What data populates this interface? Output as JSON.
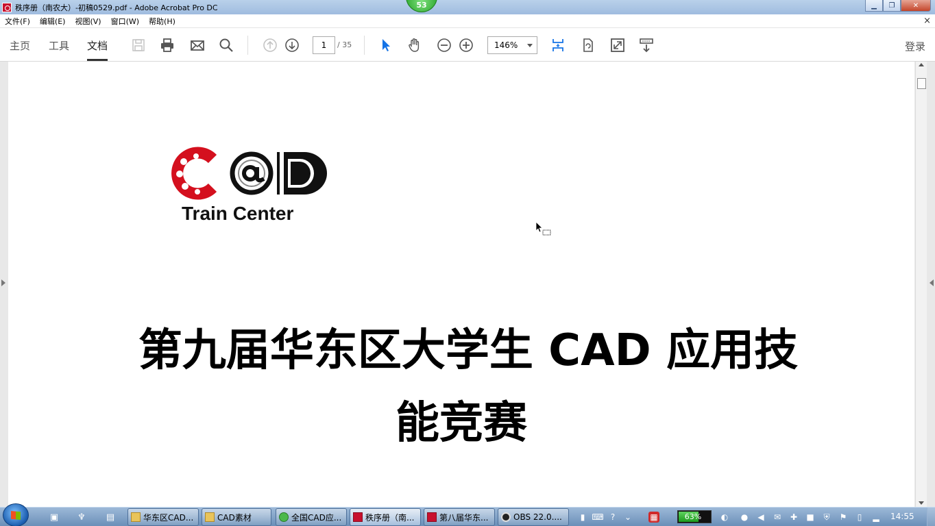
{
  "window": {
    "title": "秩序册（南农大）-初稿0529.pdf - Adobe Acrobat Pro DC",
    "badge": "53"
  },
  "menu": {
    "items": [
      "文件(F)",
      "编辑(E)",
      "视图(V)",
      "窗口(W)",
      "帮助(H)"
    ],
    "close": "×"
  },
  "toolbar": {
    "tabs": [
      "主页",
      "工具",
      "文档"
    ],
    "active_tab": "文档",
    "page_current": "1",
    "page_total": "/ 35",
    "zoom": "146%",
    "login": "登录",
    "accent": "#1473e6"
  },
  "document": {
    "logo_text": "Train Center",
    "heading_line1": "第九届华东区大学生 CAD 应用技",
    "heading_line2": "能竞赛"
  },
  "taskbar": {
    "tasks": [
      {
        "label": "华东区CAD...",
        "icon": "folder-icon"
      },
      {
        "label": "CAD素材",
        "icon": "folder-icon"
      },
      {
        "label": "全国CAD应...",
        "icon": "browser-icon"
      },
      {
        "label": "秩序册（南...",
        "icon": "pdf-icon"
      },
      {
        "label": "第八届华东...",
        "icon": "pdf-icon"
      },
      {
        "label": "OBS 22.0....",
        "icon": "obs-icon"
      }
    ],
    "battery": "63%",
    "battery_level": 0.63,
    "clock": "14:55"
  }
}
